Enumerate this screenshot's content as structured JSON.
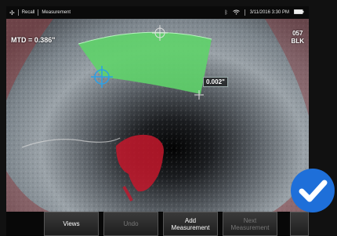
{
  "statusbar": {
    "breadcrumb_1": "Recall",
    "breadcrumb_2": "Measurement",
    "datetime": "3/11/2016 3:30 PM",
    "icons": [
      "app-logo-icon",
      "bluetooth-icon",
      "wifi-icon",
      "battery-icon"
    ]
  },
  "overlay": {
    "mtd": "MTD = 0.386\"",
    "blk_line1": "057",
    "blk_line2": "BLK",
    "measurement_value": "0.002\""
  },
  "toolbar": {
    "views": "Views",
    "undo": "Undo",
    "add_measurement": "Add\nMeasurement",
    "next_measurement": "Next\nMeasurement"
  },
  "colors": {
    "measurement_fill": "#5fd36a",
    "defect_red": "#c4172c",
    "cursor_blue": "#2aa0e6",
    "check_badge": "#1e6fd9"
  }
}
